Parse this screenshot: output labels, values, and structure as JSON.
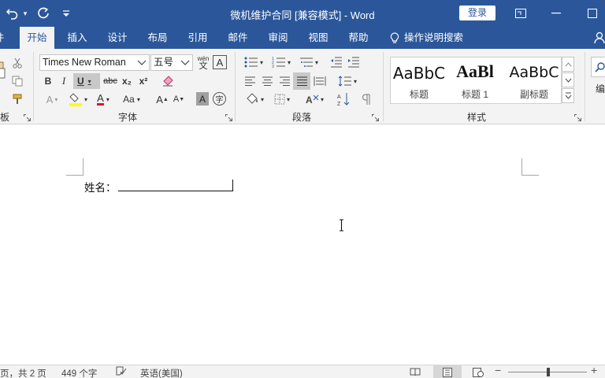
{
  "window": {
    "title": "微机维护合同 [兼容模式] - Word",
    "login_label": "登录"
  },
  "tabs": [
    {
      "label": "开始",
      "active": true
    },
    {
      "label": "插入"
    },
    {
      "label": "设计"
    },
    {
      "label": "布局"
    },
    {
      "label": "引用"
    },
    {
      "label": "邮件"
    },
    {
      "label": "审阅"
    },
    {
      "label": "视图"
    },
    {
      "label": "帮助"
    }
  ],
  "tell_me": "操作说明搜索",
  "ribbon": {
    "clipboard_label": "板",
    "font": {
      "font_name": "Times New Roman",
      "font_size": "五号",
      "label": "字体",
      "phonetic_top": "wén",
      "phonetic_bottom": "文",
      "char_border": "A",
      "bold": "B",
      "italic": "I",
      "underline": "U",
      "strike": "abc",
      "subscript": "x₂",
      "superscript": "x²",
      "text_effects": "A",
      "font_color": "A",
      "change_case": "Aa",
      "grow": "A",
      "shrink": "A",
      "shading": "A",
      "enclose": "字"
    },
    "paragraph": {
      "label": "段落"
    },
    "styles": {
      "label": "样式",
      "items": [
        {
          "preview": "AaBbC",
          "name": "标题"
        },
        {
          "preview": "AaBl",
          "name": "标题 1"
        },
        {
          "preview": "AaBbC",
          "name": "副标题"
        }
      ]
    },
    "editing_label": "编"
  },
  "document": {
    "name_label": "姓名："
  },
  "status": {
    "page_info": "页，共 2 页",
    "word_count": "449 个字",
    "language": "英语(美国)"
  },
  "colors": {
    "brand": "#2b579a",
    "highlight": "#ffff00",
    "font_color": "#e81123"
  }
}
